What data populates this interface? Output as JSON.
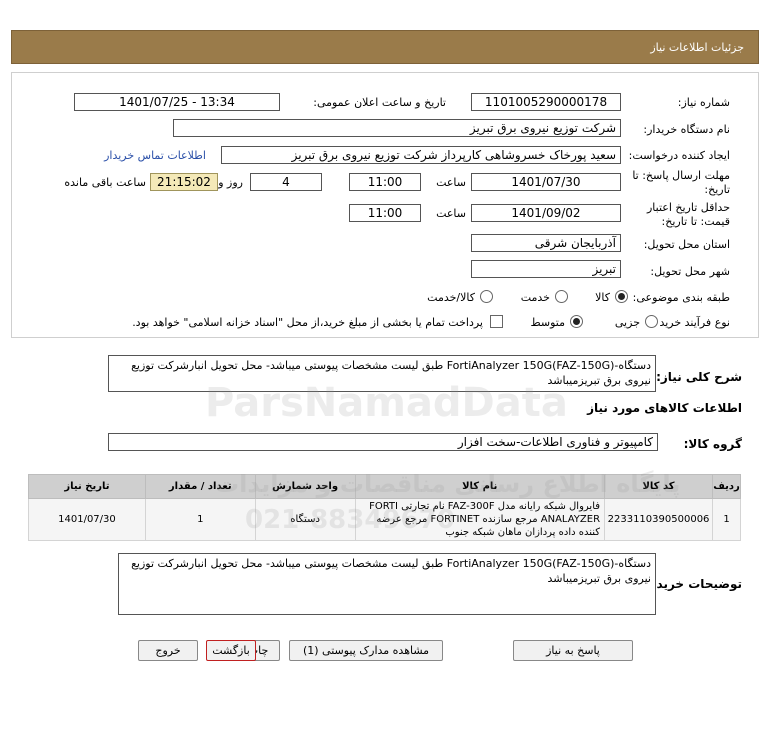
{
  "header": {
    "title": "جزئیات اطلاعات نیاز"
  },
  "form": {
    "need_number_label": "شماره نیاز:",
    "need_number": "1101005290000178",
    "announce_label": "تاریخ و ساعت اعلان عمومی:",
    "announce_value": "1401/07/25 - 13:34",
    "buyer_label": "نام دستگاه خریدار:",
    "buyer_value": "شرکت توزیع نیروی برق تبریز",
    "creator_label": "ایجاد کننده درخواست:",
    "creator_value": "سعید پورخاک خسروشاهی کارپرداز شرکت توزیع نیروی برق تبریز",
    "contact_link": "اطلاعات تماس خریدار",
    "deadline_label_1": "مهلت ارسال پاسخ: تا",
    "deadline_label_2": "تاریخ:",
    "deadline_date": "1401/07/30",
    "time_label": "ساعت",
    "deadline_time": "11:00",
    "days_value": "4",
    "days_label": "روز و",
    "remaining_time": "21:15:02",
    "remaining_label": "ساعت باقی مانده",
    "validity_label_1": "حداقل تاریخ اعتبار",
    "validity_label_2": "قیمت: تا تاریخ:",
    "validity_date": "1401/09/02",
    "validity_time_label": "ساعت",
    "validity_time": "11:00",
    "province_label": "استان محل تحویل:",
    "province_value": "آذربایجان شرقی",
    "city_label": "شهر محل تحویل:",
    "city_value": "تبریز",
    "category_label": "طبقه بندی موضوعی:",
    "category_options": [
      "کالا",
      "خدمت",
      "کالا/خدمت"
    ],
    "process_label": "نوع فرآیند خرید :",
    "process_options": [
      "جزیی",
      "متوسط"
    ],
    "payment_note": "پرداخت تمام یا بخشی از مبلغ خرید،از محل \"اسناد خزانه اسلامی\" خواهد بود."
  },
  "summary": {
    "label": "شرح کلی نیاز:",
    "text": "دستگاه-FortiAnalyzer 150G(FAZ-150G)  طبق لیست مشخصات پیوستی میباشد- محل تحویل انبارشرکت توزیع نیروی برق تبریزمیباشد"
  },
  "goods_info_title": "اطلاعات کالاهای مورد نیاز",
  "goods_group": {
    "label": "گروه کالا:",
    "value": "کامپیوتر و فناوری اطلاعات-سخت افزار"
  },
  "table": {
    "headers": [
      "ردیف",
      "کد کالا",
      "نام کالا",
      "واحد شمارش",
      "تعداد / مقدار",
      "تاریخ نیاز"
    ],
    "rows": [
      {
        "index": "1",
        "code": "2233110390500006",
        "name": "فایروال شبکه رایانه مدل FAZ-300F نام تجارتی FORTI ANALAYZER مرجع سازنده FORTINET مرجع عرضه کننده داده پردازان ماهان شبکه جنوب",
        "unit": "دستگاه",
        "qty": "1",
        "date": "1401/07/30"
      }
    ]
  },
  "buyer_notes": {
    "label": "توضیحات خریدار:",
    "text": "دستگاه-FortiAnalyzer 150G(FAZ-150G)  طبق لیست مشخصات پیوستی میباشد- محل تحویل انبارشرکت توزیع نیروی برق تبریزمیباشد"
  },
  "buttons": {
    "reply": "پاسخ به نیاز",
    "attachments": "مشاهده مدارک پیوستی (1)",
    "print": "چاپ",
    "back": "بازگشت",
    "exit": "خروج"
  },
  "watermark": {
    "line1": "ParsNamadData",
    "line2": "پایگاه اطلاع رسانی مناقصات و مزایدات",
    "phone": "021-88349670"
  }
}
